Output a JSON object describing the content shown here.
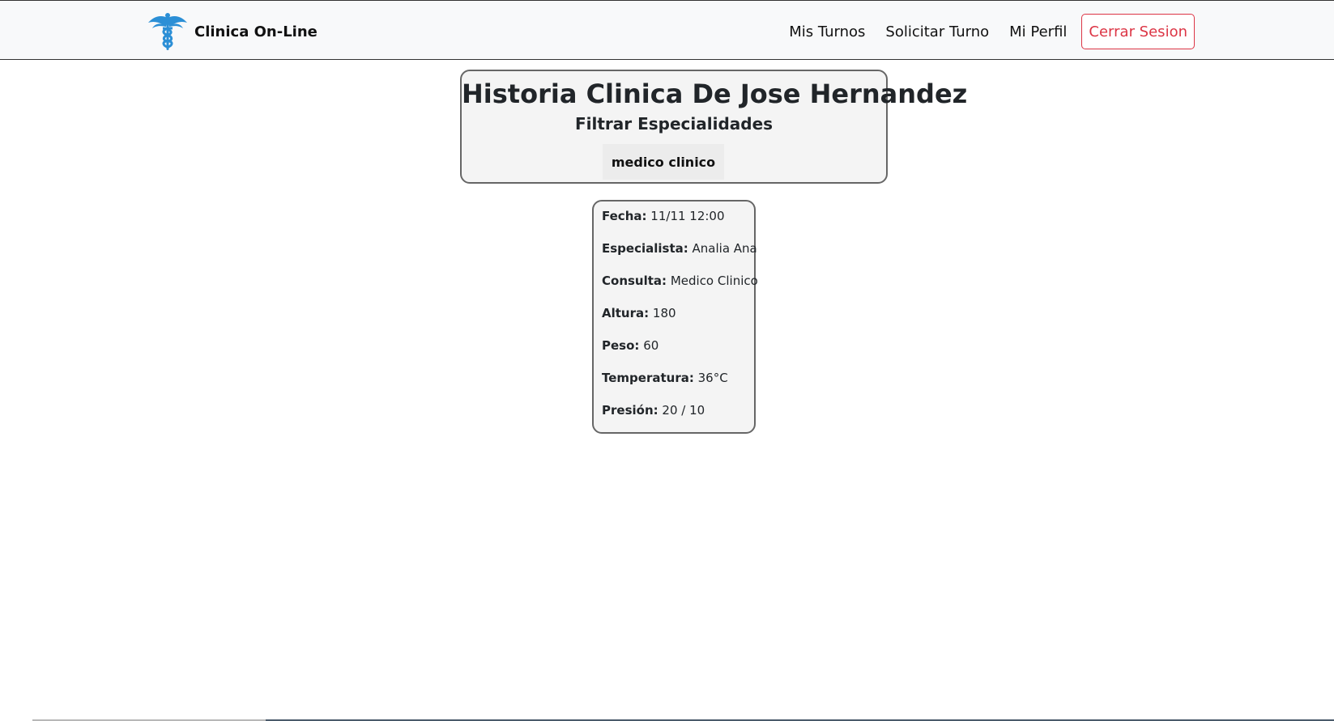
{
  "navbar": {
    "brand_name": "Clinica On-Line",
    "logo_icon": "caduceus-icon",
    "links": [
      "Mis Turnos",
      "Solicitar Turno",
      "Mi Perfil"
    ],
    "logout_label": "Cerrar Sesion"
  },
  "header": {
    "title": "Historia Clinica De Jose Hernandez",
    "subtitle": "Filtrar Especialidades",
    "filter_button": "medico clinico"
  },
  "record": {
    "rows": [
      {
        "label": "Fecha:",
        "value": "11/11 12:00"
      },
      {
        "label": "Especialista:",
        "value": "Analia Ana"
      },
      {
        "label": "Consulta:",
        "value": "Medico Clinico"
      },
      {
        "label": "Altura:",
        "value": "180"
      },
      {
        "label": "Peso:",
        "value": "60"
      },
      {
        "label": "Temperatura:",
        "value": "36°C"
      },
      {
        "label": "Presión:",
        "value": "20 / 10"
      }
    ]
  },
  "colors": {
    "logo": "#2b8fd6",
    "logout": "#dc3545",
    "card_background": "#f4f4f4",
    "navbar_background": "#f8f9fa"
  }
}
